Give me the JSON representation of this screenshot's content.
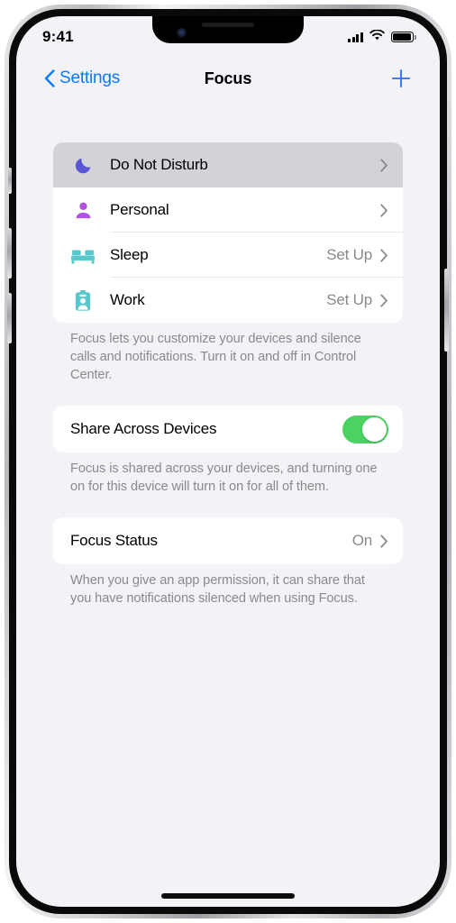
{
  "status_bar": {
    "time": "9:41",
    "signal_icon": "cellular-signal-icon",
    "wifi_icon": "wifi-icon",
    "battery_icon": "battery-full-icon"
  },
  "nav_bar": {
    "back_label": "Settings",
    "back_icon": "chevron-left-icon",
    "title": "Focus",
    "add_icon": "plus-icon",
    "accent_color": "#0a7cff"
  },
  "focus_list": {
    "rows": [
      {
        "label": "Do Not Disturb",
        "value": "",
        "icon": "moon-icon",
        "icon_color": "#5856d6",
        "selected": true
      },
      {
        "label": "Personal",
        "value": "",
        "icon": "person-icon",
        "icon_color": "#af52de",
        "selected": false
      },
      {
        "label": "Sleep",
        "value": "Set Up",
        "icon": "bed-icon",
        "icon_color": "#59c8cc",
        "selected": false
      },
      {
        "label": "Work",
        "value": "Set Up",
        "icon": "id-badge-icon",
        "icon_color": "#59c8cc",
        "selected": false
      }
    ],
    "footnote": "Focus lets you customize your devices and silence calls and notifications. Turn it on and off in Control Center."
  },
  "share_section": {
    "label": "Share Across Devices",
    "toggle_state": "on",
    "toggle_color": "#4cd263",
    "footnote": "Focus is shared across your devices, and turning one on for this device will turn it on for all of them."
  },
  "focus_status_section": {
    "label": "Focus Status",
    "value": "On",
    "footnote": "When you give an app permission, it can share that you have notifications silenced when using Focus."
  }
}
